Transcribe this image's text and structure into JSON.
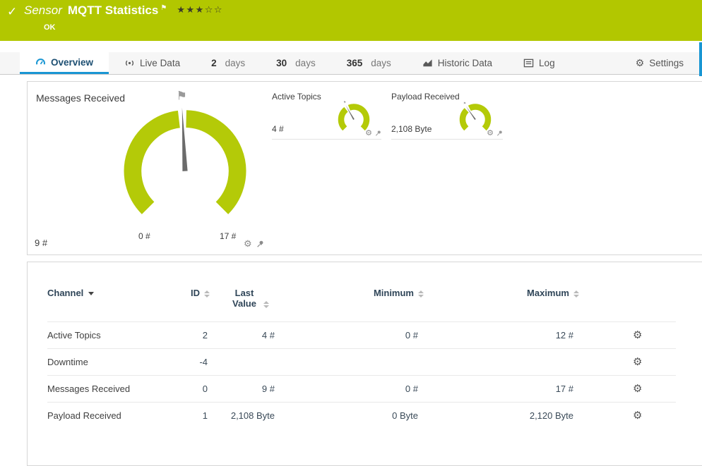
{
  "colors": {
    "header_green": "#b2c700",
    "gauge_green": "#b4ca08",
    "accent_blue": "#1996d3"
  },
  "icons": {
    "check": "✓",
    "flag": "⚑",
    "gear": "⚙",
    "stars": "★★★☆☆"
  },
  "header": {
    "type_label": "Sensor",
    "title": "MQTT Statistics",
    "status": "OK"
  },
  "tabs": [
    {
      "label": "Overview"
    },
    {
      "label": "Live Data"
    },
    {
      "value": "2",
      "unit": "days"
    },
    {
      "value": "30",
      "unit": "days"
    },
    {
      "value": "365",
      "unit": "days"
    },
    {
      "label": "Historic Data"
    },
    {
      "label": "Log"
    },
    {
      "label": "Settings"
    }
  ],
  "gauges": {
    "primary": {
      "title": "Messages Received",
      "value": "9 #",
      "scale_min": "0 #",
      "scale_max": "17 #",
      "needle_pct": 0.49
    },
    "mini": [
      {
        "title": "Active Topics",
        "value": "4 #",
        "needle_pct": 0.39
      },
      {
        "title": "Payload Received",
        "value": "2,108 Byte",
        "needle_pct": 0.37
      }
    ]
  },
  "table": {
    "headers": {
      "channel": "Channel",
      "id": "ID",
      "last_value": "Last Value",
      "minimum": "Minimum",
      "maximum": "Maximum"
    },
    "rows": [
      {
        "channel": "Active Topics",
        "id": "2",
        "last": "4 #",
        "min": "0 #",
        "max": "12 #"
      },
      {
        "channel": "Downtime",
        "id": "-4",
        "last": "",
        "min": "",
        "max": ""
      },
      {
        "channel": "Messages Received",
        "id": "0",
        "last": "9 #",
        "min": "0 #",
        "max": "17 #"
      },
      {
        "channel": "Payload Received",
        "id": "1",
        "last": "2,108 Byte",
        "min": "0 Byte",
        "max": "2,120 Byte"
      }
    ]
  }
}
